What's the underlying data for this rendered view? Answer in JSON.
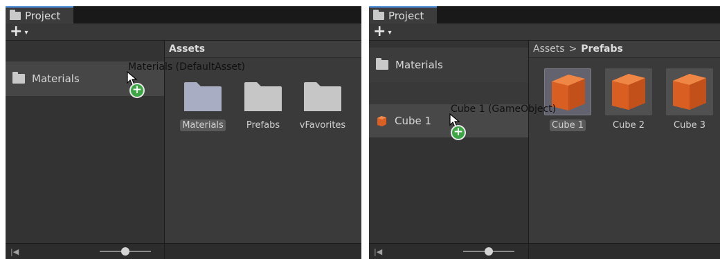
{
  "tab_title": "Project",
  "toolbar": {
    "add_symbol": "+",
    "caret_symbol": "▾"
  },
  "left": {
    "tree_items": [
      "Materials"
    ],
    "header": "Assets",
    "tiles": [
      "Materials",
      "Prefabs",
      "vFavorites"
    ],
    "drag_label": "Materials (DefaultAsset)",
    "plus_symbol": "+"
  },
  "right": {
    "tree_items": [
      "Materials",
      "Cube 1"
    ],
    "breadcrumb": {
      "root": "Assets",
      "separator": ">",
      "current": "Prefabs"
    },
    "tiles": [
      "Cube 1",
      "Cube 2",
      "Cube 3"
    ],
    "drag_label": "Cube 1 (GameObject)",
    "plus_symbol": "+"
  },
  "bottom": {
    "skip_symbol": "|◀"
  },
  "colors": {
    "folder_selected": "#a8adc4",
    "folder": "#c6c6c6",
    "cube": "#e0662a",
    "plus_badge": "#3aa644",
    "tab_accent": "#4b8ad6"
  }
}
